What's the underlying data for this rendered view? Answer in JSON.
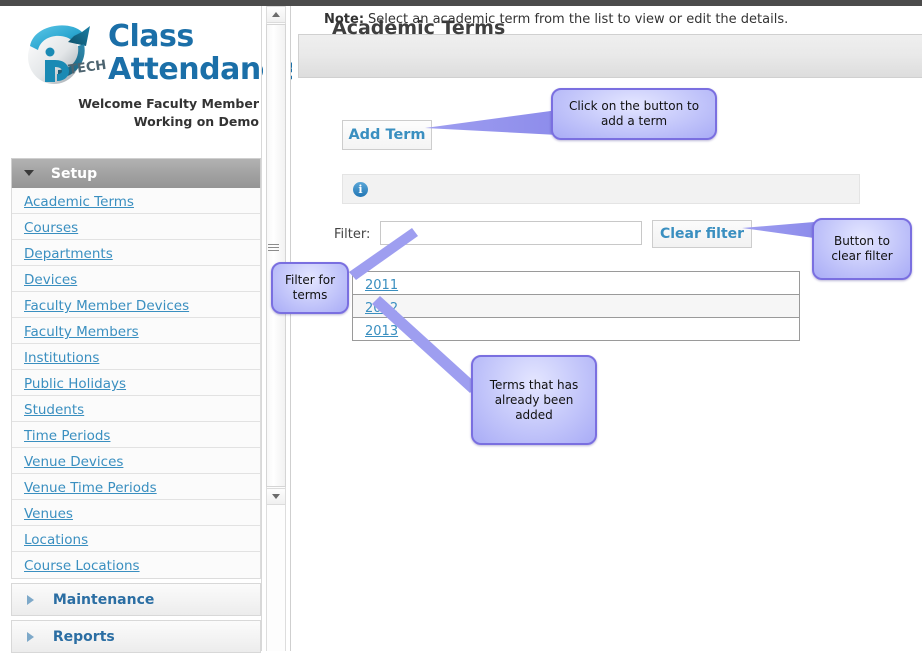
{
  "brand": {
    "logo_text": "iP TECH",
    "title_line1": "Class",
    "title_line2": "Attendance",
    "welcome_line1": "Welcome Faculty Member",
    "welcome_line2": "Working on Demo"
  },
  "sidebar": {
    "groups": [
      {
        "label": "Setup",
        "expanded": true,
        "items": [
          {
            "label": "Academic Terms"
          },
          {
            "label": "Courses"
          },
          {
            "label": "Departments"
          },
          {
            "label": "Devices"
          },
          {
            "label": "Faculty Member Devices"
          },
          {
            "label": "Faculty Members"
          },
          {
            "label": "Institutions"
          },
          {
            "label": "Public Holidays"
          },
          {
            "label": "Students"
          },
          {
            "label": "Time Periods"
          },
          {
            "label": "Venue Devices"
          },
          {
            "label": "Venue Time Periods"
          },
          {
            "label": "Venues"
          },
          {
            "label": "Locations"
          },
          {
            "label": "Course Locations"
          }
        ]
      },
      {
        "label": "Maintenance",
        "expanded": false,
        "items": []
      },
      {
        "label": "Reports",
        "expanded": false,
        "items": []
      }
    ]
  },
  "main": {
    "page_title": "Academic Terms",
    "add_term_label": "Add Term",
    "note": {
      "icon": "info-icon",
      "label": "Note:",
      "text": "Select an academic term from the list to view or edit the details."
    },
    "filter": {
      "label": "Filter:",
      "value": "",
      "placeholder": "",
      "clear_label": "Clear filter"
    },
    "terms": [
      {
        "label": "2011"
      },
      {
        "label": "2012"
      },
      {
        "label": "2013"
      }
    ]
  },
  "callouts": {
    "add_term": "Click on the button to add a term",
    "clear_filter": "Button to clear filter",
    "filter": "Filter for terms",
    "terms_list": "Terms that has already been added"
  },
  "colors": {
    "accent_link": "#3a8fc0",
    "brand_blue": "#1b6fa8",
    "callout_border": "#7a6fe0",
    "callout_fill": "#a9acf6",
    "setup_header": "#a2a2a2"
  },
  "scrollbar": {
    "up_arrow": "triangle-up-icon",
    "down_arrow": "triangle-down-icon",
    "grip": "resize-grip-icon"
  }
}
